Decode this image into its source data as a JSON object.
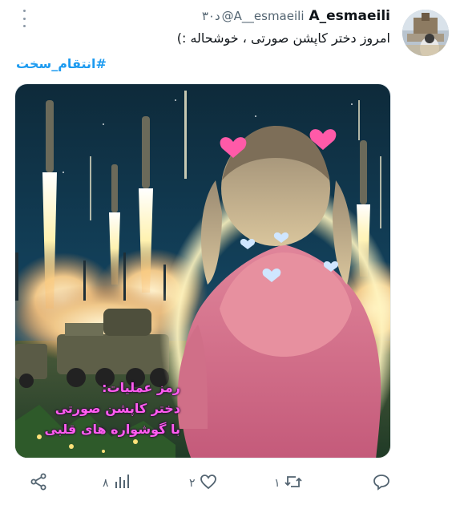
{
  "author": {
    "display_name": "A_esmaeili",
    "handle": "@A__esmaeili",
    "timestamp": "۳۰د"
  },
  "tweet": {
    "text": "امروز دختر کاپشن صورتی ، خوشحاله :)",
    "hashtag": "#انتقام_سخت"
  },
  "media": {
    "caption_lines": [
      "رمز عملیات:",
      "دختر کاپشن صورتی",
      "با گوشواره های قلبی"
    ]
  },
  "actions": {
    "views": "۸",
    "likes": "۲",
    "retweets": "۱",
    "replies": ""
  },
  "colors": {
    "accent": "#1d9bf0",
    "muted": "#536471",
    "caption": "#ff5cf0"
  }
}
